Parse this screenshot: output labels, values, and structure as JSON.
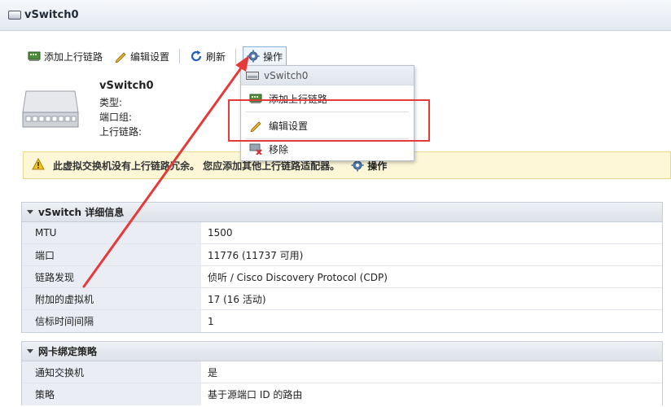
{
  "window": {
    "title": "vSwitch0"
  },
  "toolbar": {
    "add_uplink": "添加上行链路",
    "edit_settings": "编辑设置",
    "refresh": "刷新",
    "actions": "操作"
  },
  "switch": {
    "name": "vSwitch0",
    "type_label": "类型:",
    "portgroups_label": "端口组:",
    "uplinks_label": "上行链路:"
  },
  "warning": {
    "text": "此虚拟交换机没有上行链路冗余。 您应添加其他上行链路适配器。",
    "action": "操作"
  },
  "details": {
    "title": "vSwitch 详细信息",
    "rows": [
      {
        "key": "MTU",
        "value": "1500"
      },
      {
        "key": "端口",
        "value": "11776 (11737 可用)"
      },
      {
        "key": "链路发现",
        "value": "侦听 / Cisco Discovery Protocol (CDP)"
      },
      {
        "key": "附加的虚拟机",
        "value": "17 (16 活动)"
      },
      {
        "key": "信标时间间隔",
        "value": "1"
      }
    ]
  },
  "nic_teaming": {
    "title": "网卡绑定策略",
    "rows": [
      {
        "key": "通知交换机",
        "value": "是"
      },
      {
        "key": "策略",
        "value": "基于源端口 ID 的路由"
      }
    ]
  },
  "menu": {
    "header": "vSwitch0",
    "items": [
      {
        "label": "添加上行链路",
        "icon": "nic-icon"
      },
      {
        "label": "编辑设置",
        "icon": "pencil-icon"
      },
      {
        "label": "移除",
        "icon": "remove-icon"
      }
    ]
  },
  "colors": {
    "annotation_red": "#e53a3a",
    "warning_bg": "#fdf7d8",
    "panel_key_bg": "#eaeef4"
  }
}
